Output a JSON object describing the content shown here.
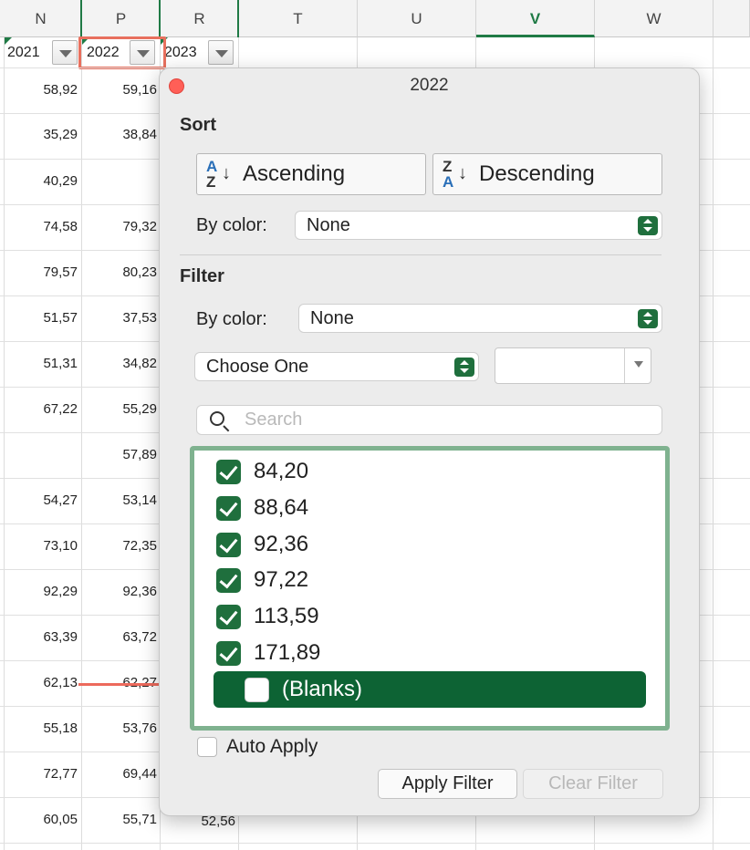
{
  "columns": {
    "N": "N",
    "P": "P",
    "R": "R",
    "T": "T",
    "U": "U",
    "V": "V",
    "W": "W"
  },
  "header_row": {
    "n_label": "2021",
    "p_label": "2022",
    "r_label": "2023"
  },
  "rows": [
    {
      "n": "58,92",
      "p": "59,16"
    },
    {
      "n": "35,29",
      "p": "38,84"
    },
    {
      "n": "40,29",
      "p": ""
    },
    {
      "n": "74,58",
      "p": "79,32"
    },
    {
      "n": "79,57",
      "p": "80,23"
    },
    {
      "n": "51,57",
      "p": "37,53"
    },
    {
      "n": "51,31",
      "p": "34,82"
    },
    {
      "n": "67,22",
      "p": "55,29"
    },
    {
      "n": "",
      "p": "57,89"
    },
    {
      "n": "54,27",
      "p": "53,14"
    },
    {
      "n": "73,10",
      "p": "72,35"
    },
    {
      "n": "92,29",
      "p": "92,36"
    },
    {
      "n": "63,39",
      "p": "63,72"
    },
    {
      "n": "62,13",
      "p": "62,27"
    },
    {
      "n": "55,18",
      "p": "53,76"
    },
    {
      "n": "72,77",
      "p": "69,44"
    },
    {
      "n": "60,05",
      "p": "55,71",
      "r": "52,56"
    }
  ],
  "popup": {
    "title": "2022",
    "sort_title": "Sort",
    "ascending_label": "Ascending",
    "descending_label": "Descending",
    "az_top": "A",
    "az_bottom": "Z",
    "za_top": "Z",
    "za_bottom": "A",
    "arrow_glyph": "↓",
    "sort_by_color_label": "By color:",
    "sort_by_color_value": "None",
    "filter_title": "Filter",
    "filter_by_color_label": "By color:",
    "filter_by_color_value": "None",
    "condition_value": "Choose One",
    "search_placeholder": "Search",
    "list_items": [
      {
        "label": "84,20",
        "checked": true
      },
      {
        "label": "88,64",
        "checked": true
      },
      {
        "label": "92,36",
        "checked": true
      },
      {
        "label": "97,22",
        "checked": true
      },
      {
        "label": "113,59",
        "checked": true
      },
      {
        "label": "171,89",
        "checked": true
      },
      {
        "label": "(Blanks)",
        "checked": false
      }
    ],
    "auto_apply_label": "Auto Apply",
    "apply_filter_label": "Apply Filter",
    "clear_filter_label": "Clear Filter"
  },
  "colors": {
    "accent_green": "#1f6f3d",
    "selected_row": "#0d6334",
    "annotation_red": "#ec6a5c",
    "list_border": "#7fb28f"
  }
}
